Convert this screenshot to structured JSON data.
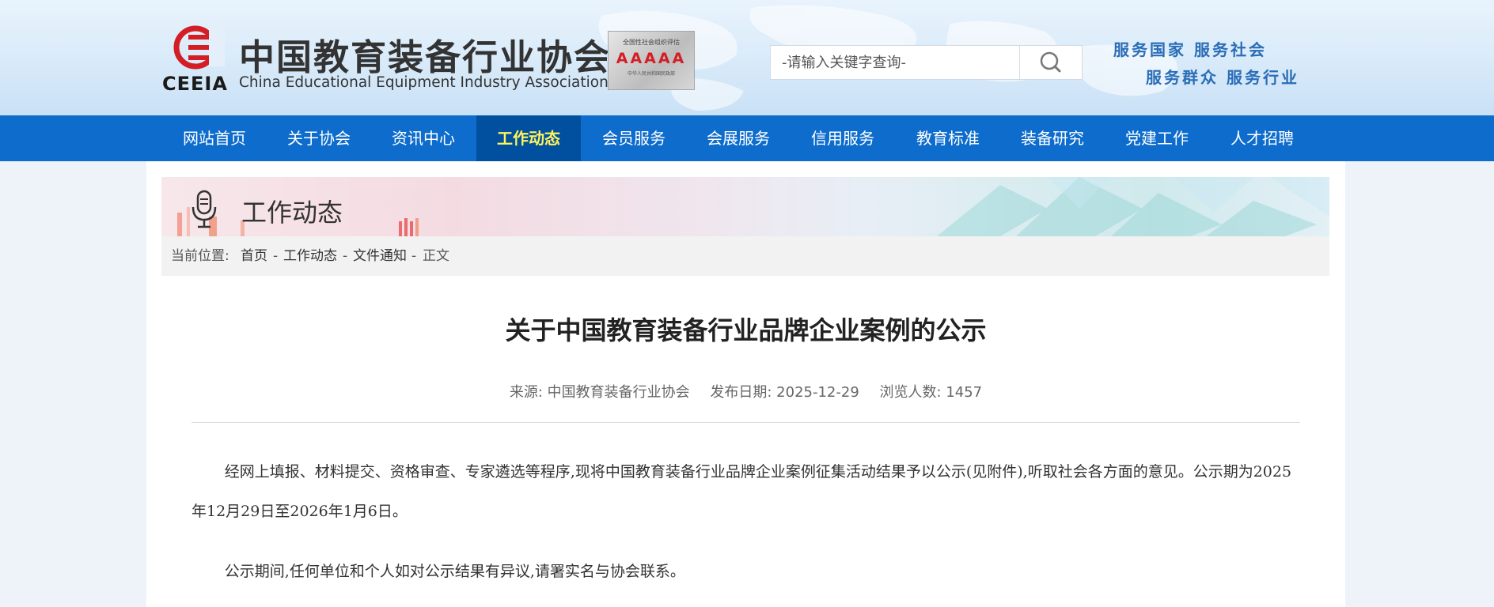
{
  "header": {
    "logo_text": "CEEIA",
    "org_name_cn": "中国教育装备行业协会",
    "org_name_en": "China Educational Equipment Industry Association",
    "badge": {
      "top": "全国性社会组织评估",
      "grade": "AAAAA",
      "bottom": "中华人民共和国民政部"
    },
    "search": {
      "placeholder": "-请输入关键字查询-"
    },
    "slogan_line1": "服务国家  服务社会",
    "slogan_line2": "服务群众  服务行业",
    "colors": {
      "logo_red": "#d31e25",
      "slogan_blue": "#2a6db7"
    }
  },
  "nav": {
    "items": [
      {
        "label": "网站首页"
      },
      {
        "label": "关于协会"
      },
      {
        "label": "资讯中心"
      },
      {
        "label": "工作动态",
        "active": true
      },
      {
        "label": "会员服务"
      },
      {
        "label": "会展服务"
      },
      {
        "label": "信用服务"
      },
      {
        "label": "教育标准"
      },
      {
        "label": "装备研究"
      },
      {
        "label": "党建工作"
      },
      {
        "label": "人才招聘"
      }
    ],
    "colors": {
      "bg": "#0d6ccc",
      "active_bg": "#00509f",
      "active_text": "#fff45a"
    }
  },
  "section": {
    "title": "工作动态",
    "icon": "microphone-icon"
  },
  "breadcrumb": {
    "prefix": "当前位置:",
    "items": [
      "首页",
      "工作动态",
      "文件通知",
      "正文"
    ],
    "separator": "-"
  },
  "article": {
    "title": "关于中国教育装备行业品牌企业案例的公示",
    "source": "来源:  中国教育装备行业协会",
    "date": "发布日期:  2025-12-29",
    "views": "浏览人数:  1457",
    "paragraphs": [
      "经网上填报、材料提交、资格审查、专家遴选等程序,现将中国教育装备行业品牌企业案例征集活动结果予以公示(见附件),听取社会各方面的意见。公示期为2025年12月29日至2026年1月6日。",
      "公示期间,任何单位和个人如对公示结果有异议,请署实名与协会联系。"
    ]
  }
}
